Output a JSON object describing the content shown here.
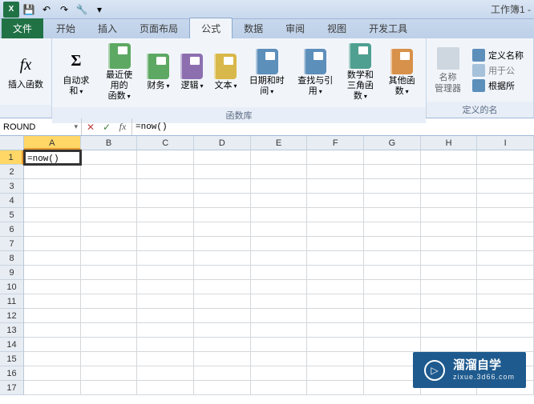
{
  "title": "工作簿1 -",
  "qat": {
    "save": "💾",
    "undo": "↶",
    "redo": "↷",
    "tool": "🔧"
  },
  "tabs": {
    "file": "文件",
    "home": "开始",
    "insert": "插入",
    "layout": "页面布局",
    "formulas": "公式",
    "data": "数据",
    "review": "审阅",
    "view": "视图",
    "dev": "开发工具"
  },
  "ribbon": {
    "insert_fn": "插入函数",
    "autosum": "自动求和",
    "recent": "最近使用的\n函数",
    "financial": "财务",
    "logical": "逻辑",
    "text": "文本",
    "datetime": "日期和时间",
    "lookup": "查找与引用",
    "math": "数学和\n三角函数",
    "more_fn": "其他函数",
    "group_lib": "函数库",
    "name_mgr": "名称\n管理器",
    "define_name": "定义名称",
    "use_formula": "用于公",
    "create_sel": "根据所",
    "group_names": "定义的名"
  },
  "formula_bar": {
    "name_box": "ROUND",
    "formula": "=now()"
  },
  "columns": [
    "A",
    "B",
    "C",
    "D",
    "E",
    "F",
    "G",
    "H",
    "I"
  ],
  "rows": [
    "1",
    "2",
    "3",
    "4",
    "5",
    "6",
    "7",
    "8",
    "9",
    "10",
    "11",
    "12",
    "13",
    "14",
    "15",
    "16",
    "17"
  ],
  "active_cell_value": "=now()",
  "watermark": {
    "main": "溜溜自学",
    "sub": "zixue.3d66.com"
  },
  "icons": {
    "fx": "fx",
    "sigma": "Σ",
    "dropdown": "▾"
  },
  "colors": {
    "book_green": "#5da863",
    "book_purple": "#8d6fb0",
    "book_yellow": "#d8b84a",
    "book_blue": "#5d8fbb",
    "book_teal": "#4fa090",
    "book_orange": "#d8914a"
  }
}
